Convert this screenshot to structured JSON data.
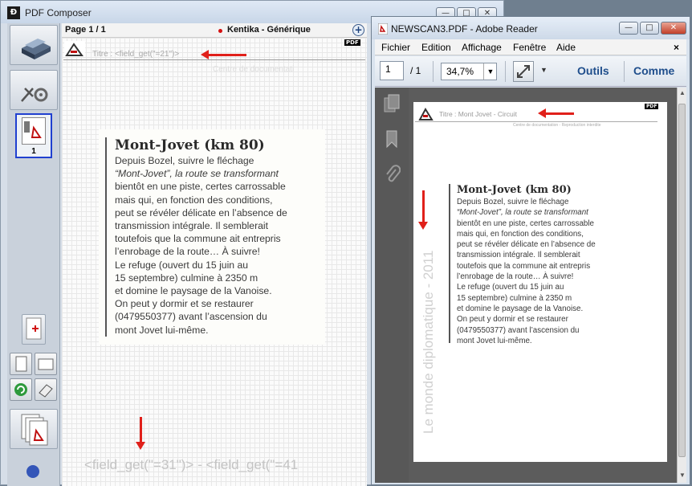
{
  "composer": {
    "title": "PDF Composer",
    "window_buttons": [
      "—",
      "□",
      "✕"
    ],
    "thumbnail_page": "1",
    "page_header": {
      "page_label": "Page 1 / 1",
      "document_name": "Kentika - Générique"
    },
    "title_field": "Titre : <field_get(\"=21\")>",
    "header_ghost": "Centre de documentati",
    "footer_field": "<field_get(\"=31\")> - <field_get(\"=41",
    "pdf_badge": "PDF"
  },
  "article": {
    "heading": "Mont-Jovet (km 80)",
    "lines": [
      "Depuis Bozel, suivre le fléchage",
      "“Mont-Jovet”, la route se transformant",
      "bientôt en une piste, certes carrossable",
      "mais qui, en fonction des conditions,",
      "peut se révéler délicate en l’absence de",
      "transmission intégrale. Il semblerait",
      "toutefois que la commune ait entrepris",
      "l’enrobage de la route… À suivre!",
      "Le refuge (ouvert du 15 juin au",
      "15 septembre) culmine à 2350 m",
      "et domine le paysage de la Vanoise.",
      "On peut y dormir et se restaurer",
      "(0479550377) avant l’ascension du",
      "mont Jovet lui-même."
    ]
  },
  "reader": {
    "title": "NEWSCAN3.PDF - Adobe Reader",
    "window_buttons": [
      "—",
      "□",
      "✕"
    ],
    "menu": [
      "Fichier",
      "Edition",
      "Affichage",
      "Fenêtre",
      "Aide"
    ],
    "menu_close": "×",
    "toolbar": {
      "page_value": "1",
      "page_total": "/ 1",
      "zoom": "34,7%",
      "tools_label": "Outils",
      "comment_label": "Comme"
    },
    "pdf_title": "Titre : Mont Jovet - Circuit",
    "pdf_subheader": "Centre de documentation - Reproduction interdite",
    "side_text": "Le monde diplomatique - 2011",
    "pdf_badge": "PDF"
  },
  "colors": {
    "arrow_red": "#e0201a",
    "reader_blue_text": "#1f4e8c",
    "reader_gray_panel": "#5c5c5c"
  }
}
